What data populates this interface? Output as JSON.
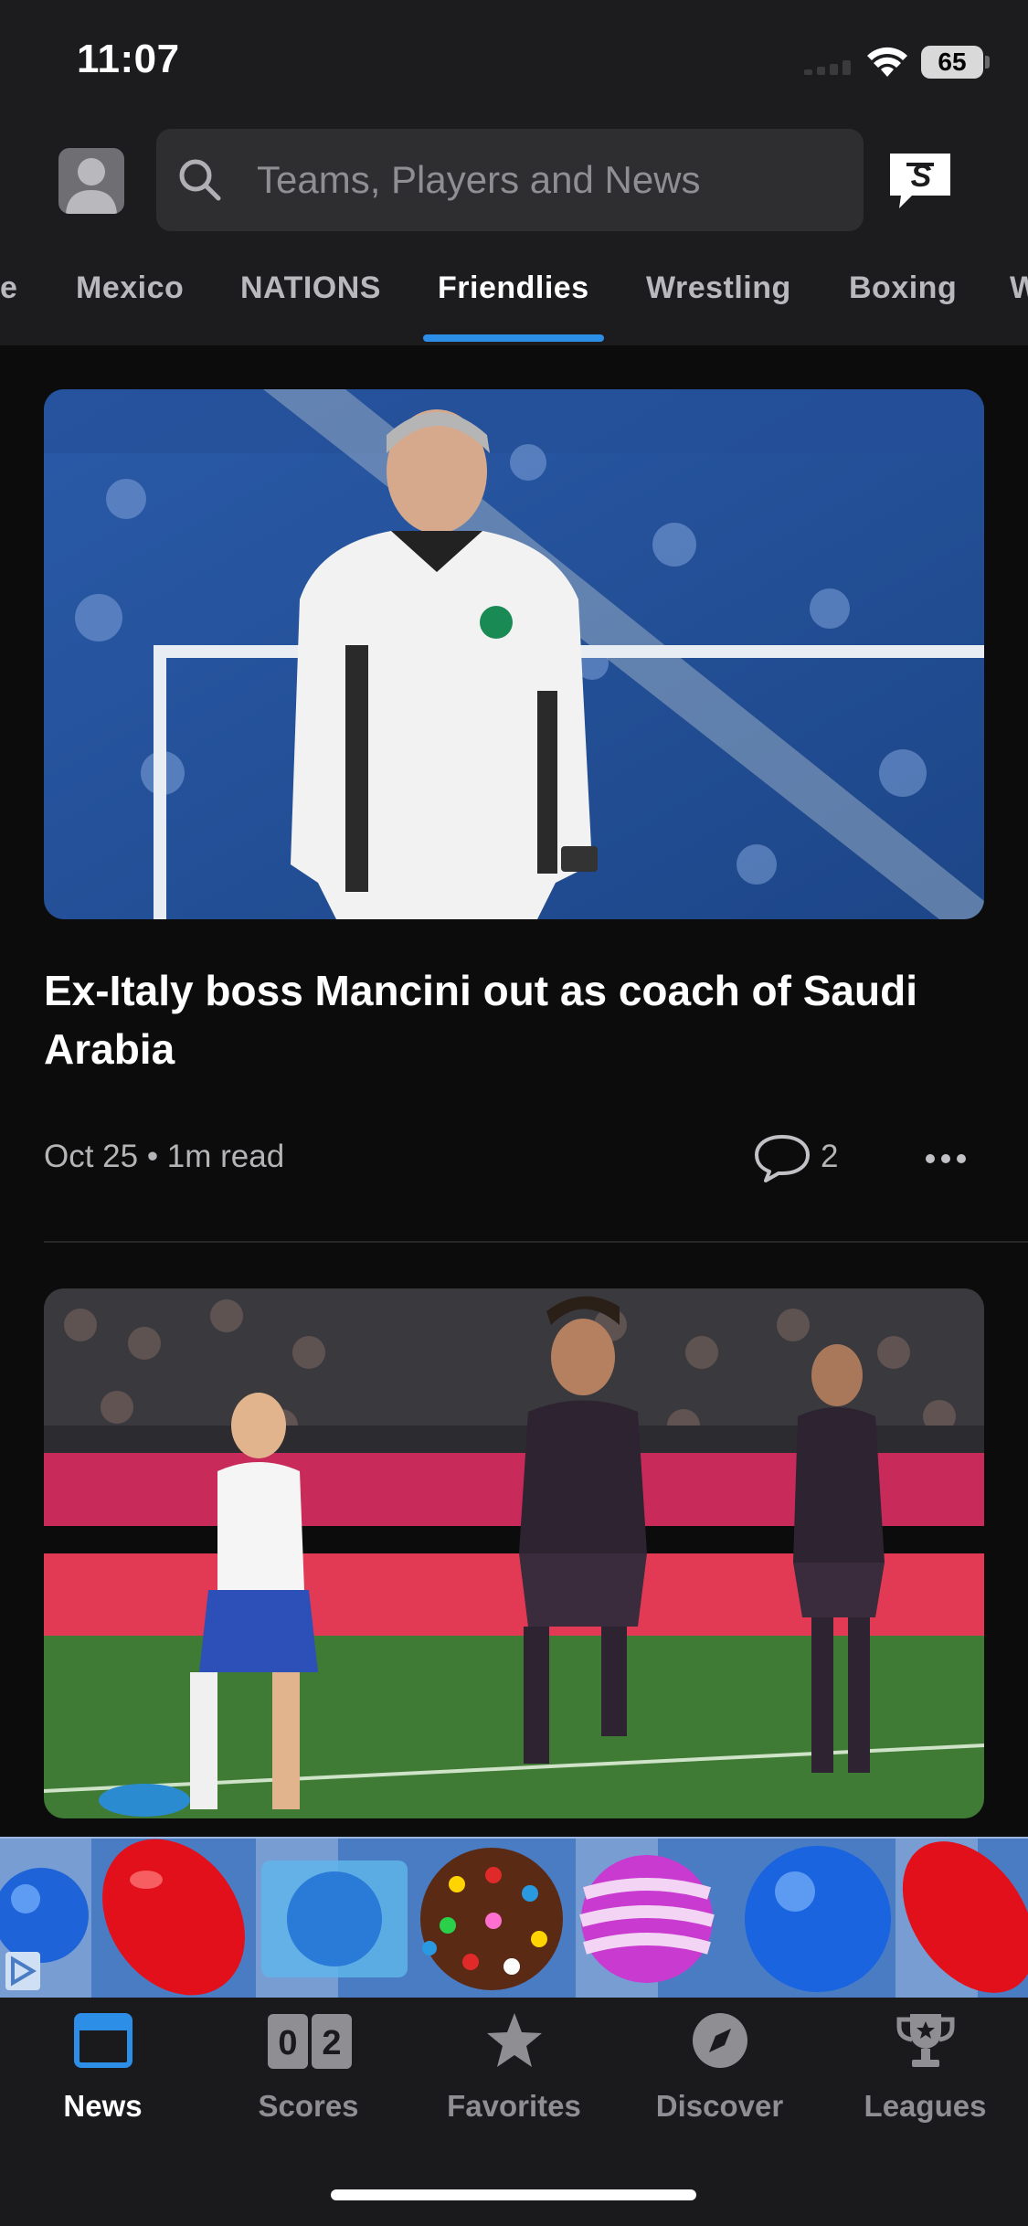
{
  "status_bar": {
    "time": "11:07",
    "battery": "65"
  },
  "search": {
    "placeholder": "Teams, Players and News"
  },
  "tabs": [
    {
      "label": "e"
    },
    {
      "label": "Mexico"
    },
    {
      "label": "NATIONS"
    },
    {
      "label": "Friendlies",
      "active": true
    },
    {
      "label": "Wrestling"
    },
    {
      "label": "Boxing"
    },
    {
      "label": "W"
    }
  ],
  "articles": [
    {
      "headline": "Ex-Italy boss Mancini out as coach of Saudi Arabia",
      "meta": "Oct 25 • 1m read",
      "comments": "2"
    }
  ],
  "bottom_nav": [
    {
      "label": "News",
      "icon": "news-icon",
      "active": true
    },
    {
      "label": "Scores",
      "icon": "scores-icon",
      "score_left": "0",
      "score_right": "2"
    },
    {
      "label": "Favorites",
      "icon": "star-icon"
    },
    {
      "label": "Discover",
      "icon": "compass-icon"
    },
    {
      "label": "Leagues",
      "icon": "trophy-icon"
    }
  ],
  "colors": {
    "accent": "#2d8ee8",
    "header_bg": "#1c1c1e",
    "page_bg": "#0c0c0d"
  }
}
